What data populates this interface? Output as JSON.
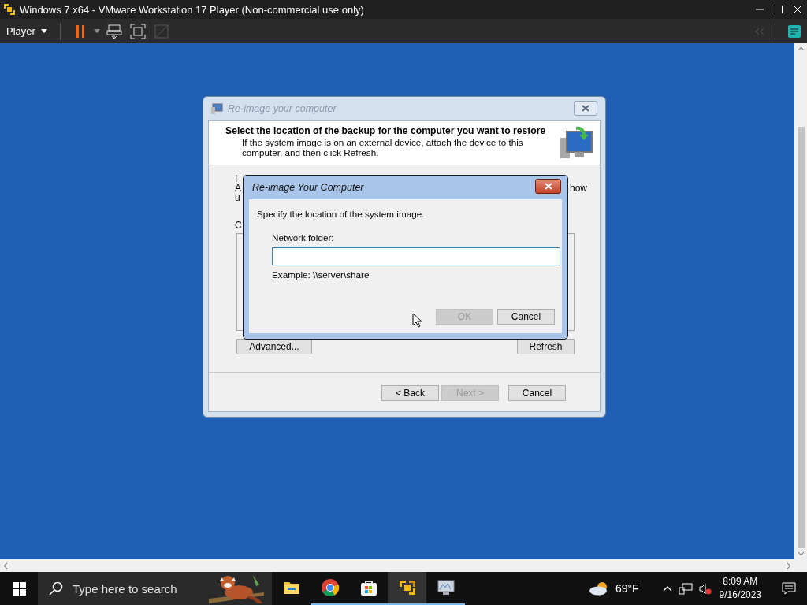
{
  "window": {
    "title": "Windows 7 x64 - VMware Workstation 17 Player (Non-commercial use only)"
  },
  "toolbar": {
    "menu": "Player"
  },
  "dialog": {
    "title": "Re-image your computer",
    "heading": "Select the location of the backup for the computer you want to restore",
    "description": "If the system image is on an external device, attach the device to this computer, and then click Refresh.",
    "obscured_left": [
      "I",
      "A",
      "u",
      "C"
    ],
    "obscured_right": "how",
    "buttons": [
      {
        "label": "Advanced..."
      },
      {
        "label": "Refresh"
      }
    ],
    "nav_buttons": [
      {
        "label": "< Back",
        "disabled": false
      },
      {
        "label": "Next >",
        "disabled": true
      },
      {
        "label": "Cancel",
        "disabled": false
      }
    ]
  },
  "subdialog": {
    "title": "Re-image Your Computer",
    "prompt": "Specify the location of the system image.",
    "field_label": "Network folder:",
    "example": "Example: \\\\server\\share",
    "buttons": [
      {
        "label": "OK",
        "disabled": true
      },
      {
        "label": "Cancel",
        "disabled": false
      }
    ]
  },
  "taskbar": {
    "search_placeholder": "Type here to search",
    "apps": [
      {
        "kind": "folder",
        "running": false,
        "selected": false
      },
      {
        "kind": "browser",
        "running": true,
        "selected": false
      },
      {
        "kind": "store",
        "running": true,
        "selected": false
      },
      {
        "kind": "vmware",
        "running": true,
        "selected": true
      },
      {
        "kind": "monitor",
        "running": true,
        "selected": false
      }
    ],
    "weather": "69°F",
    "time": "8:09 AM",
    "date": "9/16/2023"
  }
}
